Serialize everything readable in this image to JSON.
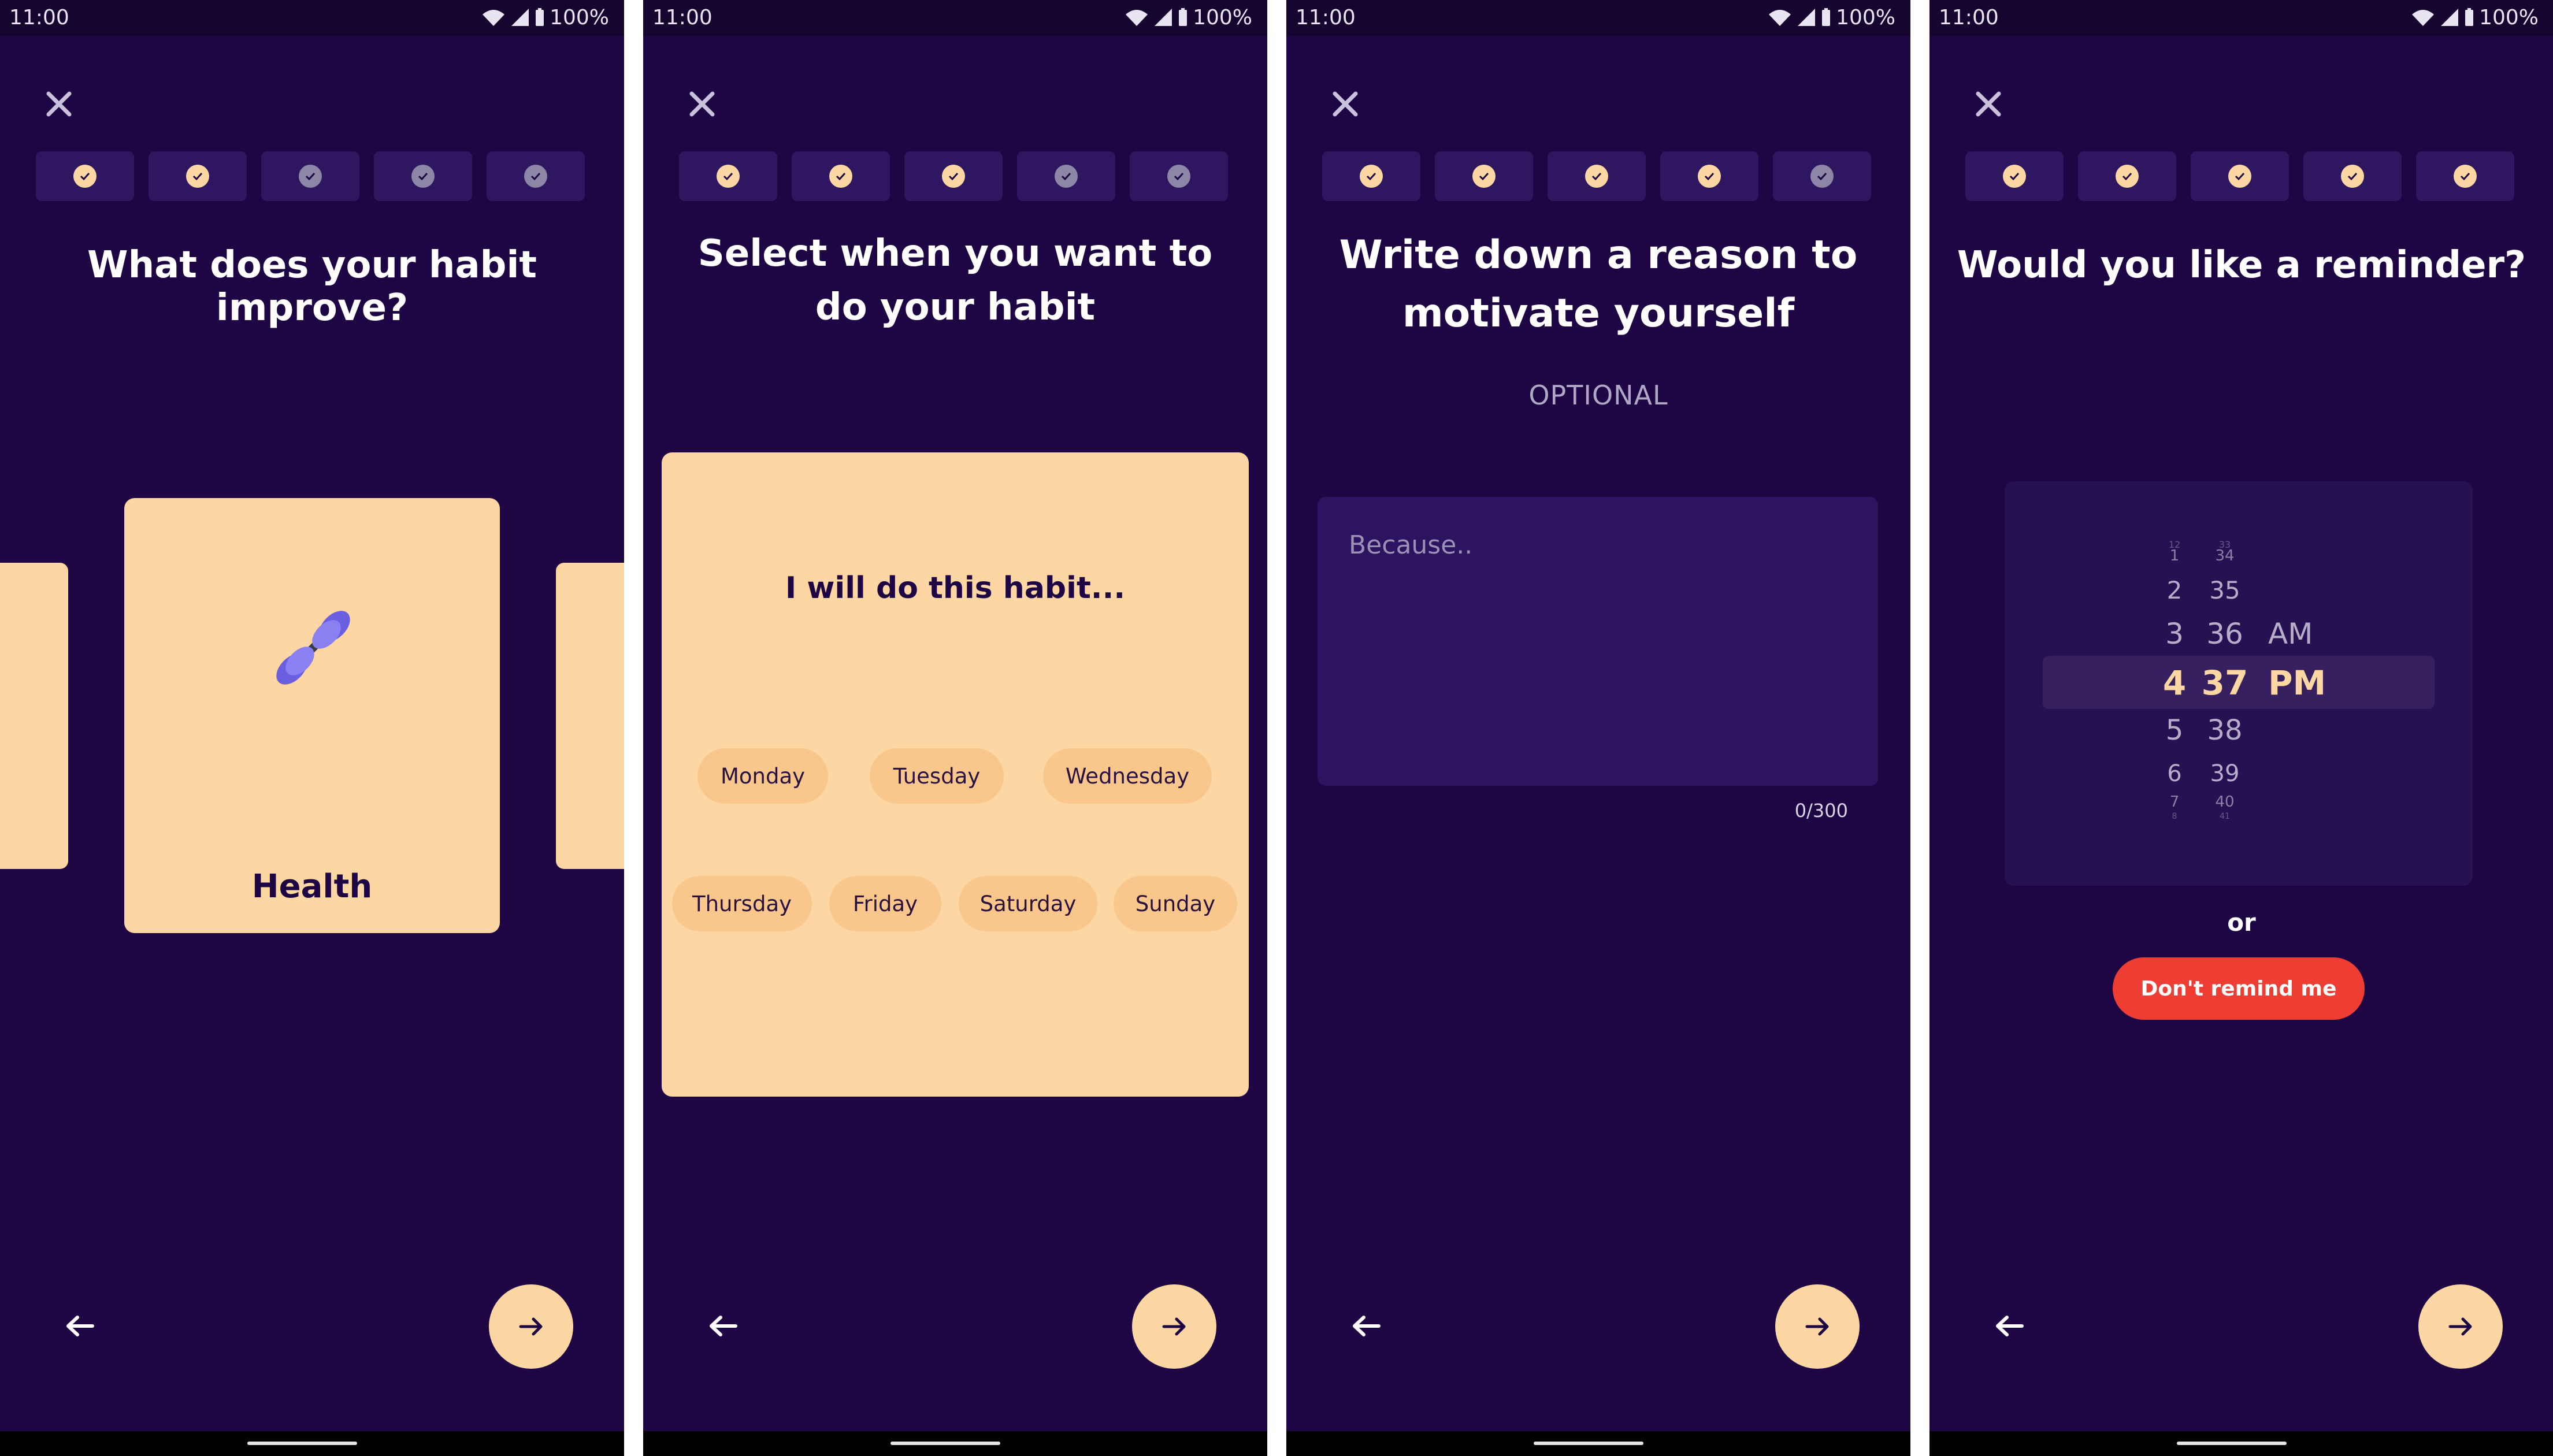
{
  "status_bar": {
    "time": "11:00",
    "battery": "100%"
  },
  "colors": {
    "background": "#1e0644",
    "accent": "#fcd7a4",
    "danger": "#ee3e33"
  },
  "icons": {
    "close": "close-icon",
    "check": "check-icon",
    "back": "arrow-left-icon",
    "next": "arrow-right-icon",
    "category": "dumbbell-icon"
  },
  "progress": {
    "screen1": [
      "complete",
      "complete",
      "pending",
      "pending",
      "pending"
    ],
    "screen2": [
      "complete",
      "complete",
      "complete",
      "pending",
      "pending"
    ],
    "screen3": [
      "complete",
      "complete",
      "complete",
      "complete",
      "pending"
    ],
    "screen4": [
      "complete",
      "complete",
      "complete",
      "complete",
      "complete"
    ]
  },
  "screen1": {
    "title": "What does your habit improve?",
    "selected_category": "Health"
  },
  "screen2": {
    "title_line1": "Select when you want to",
    "title_line2": "do your habit",
    "card_heading": "I will do this habit...",
    "days": [
      "Monday",
      "Tuesday",
      "Wednesday",
      "Thursday",
      "Friday",
      "Saturday",
      "Sunday"
    ]
  },
  "screen3": {
    "title_line1": "Write down a reason to",
    "title_line2": "motivate yourself",
    "subtitle": "OPTIONAL",
    "placeholder": "Because..",
    "value": "",
    "counter": "0/300"
  },
  "screen4": {
    "title": "Would you like a reminder?",
    "hours": [
      "12",
      "1",
      "2",
      "3",
      "4",
      "5",
      "6",
      "7",
      "8"
    ],
    "minutes": [
      "33",
      "34",
      "35",
      "36",
      "37",
      "38",
      "39",
      "40",
      "41"
    ],
    "meridiem": [
      "AM",
      "PM"
    ],
    "selected": {
      "hour": "4",
      "minute": "37",
      "meridiem": "PM"
    },
    "or_label": "or",
    "dont_remind_label": "Don't remind me"
  }
}
